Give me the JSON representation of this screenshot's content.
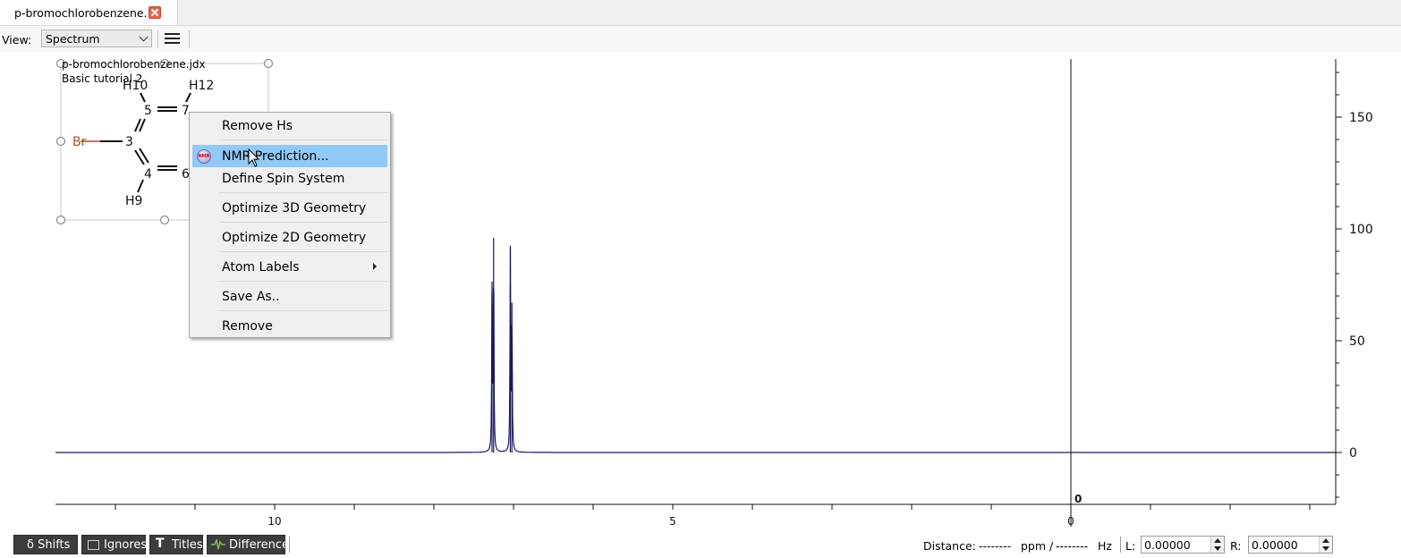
{
  "tab": {
    "title": "p-bromochlorobenzene...",
    "close_icon": "close-icon"
  },
  "toolbar": {
    "view_label": "View:",
    "view_value": "Spectrum",
    "menu_icon": "hamburger-menu-icon"
  },
  "spectrum": {
    "file_name": "p-bromochlorobenzene.jdx",
    "subtitle": "Basic tutorial 2",
    "cursor_readout": "0"
  },
  "molecule": {
    "atoms": [
      "Br",
      "3",
      "5",
      "4",
      "7",
      "6",
      "H10",
      "H12",
      "H9"
    ],
    "br_color": "#a0522d"
  },
  "context_menu": {
    "items": [
      {
        "label": "Remove Hs"
      },
      {
        "label": "NMR Prediction..."
      },
      {
        "label": "Define Spin System"
      },
      {
        "label": "Optimize 3D Geometry"
      },
      {
        "label": "Optimize 2D Geometry"
      },
      {
        "label": "Atom Labels"
      },
      {
        "label": "Save As.."
      },
      {
        "label": "Remove"
      }
    ],
    "highlight_color": "#91c9f7"
  },
  "bottom_bar": {
    "buttons": [
      {
        "label": "δ Shifts"
      },
      {
        "label": "Ignores"
      },
      {
        "label": "Titles"
      },
      {
        "label": "Difference"
      }
    ],
    "distance_label": "Distance:",
    "distance_ppm": "--------",
    "ppm_unit": "ppm /",
    "distance_hz": "--------",
    "hz_unit": "Hz",
    "l_label": "L:",
    "l_value": "0.00000",
    "r_label": "R:",
    "r_value": "0.00000"
  },
  "chart_data": {
    "type": "line",
    "x_axis": {
      "ticks": [
        10,
        5,
        0
      ],
      "reversed": true
    },
    "y_axis": {
      "ticks": [
        150,
        100,
        50,
        0
      ],
      "position": "right"
    },
    "peaks": [
      {
        "ppm": 7.27,
        "height": 72
      },
      {
        "ppm": 7.25,
        "height": 96
      },
      {
        "ppm": 7.04,
        "height": 91
      },
      {
        "ppm": 7.02,
        "height": 67
      }
    ],
    "baseline": 0,
    "line_color": "#1a1a5e"
  }
}
